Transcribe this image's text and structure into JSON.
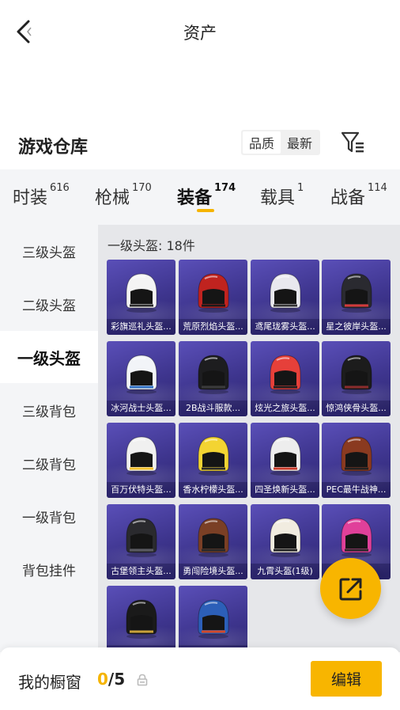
{
  "header": {
    "title": "资产"
  },
  "section": {
    "title": "游戏仓库",
    "sort_options": [
      "品质",
      "最新"
    ]
  },
  "tabs": [
    {
      "label": "时装",
      "count": "616"
    },
    {
      "label": "枪械",
      "count": "170"
    },
    {
      "label": "装备",
      "count": "174"
    },
    {
      "label": "载具",
      "count": "1"
    },
    {
      "label": "战备",
      "count": "114"
    }
  ],
  "sidebar": {
    "items": [
      "三级头盔",
      "二级头盔",
      "一级头盔",
      "三级背包",
      "二级背包",
      "一级背包",
      "背包挂件"
    ]
  },
  "content": {
    "header": "一级头盔: 18件",
    "items": [
      {
        "name": "彩旗巡礼头盔...",
        "colors": [
          "#f4f4f4",
          "#2b2b2b"
        ]
      },
      {
        "name": "荒原烈焰头盔...",
        "colors": [
          "#c0231f",
          "#1a1a1a"
        ]
      },
      {
        "name": "鸢尾珑雾头盔...",
        "colors": [
          "#e8e8ee",
          "#333333"
        ]
      },
      {
        "name": "星之彼岸头盔...",
        "colors": [
          "#2a2a30",
          "#d23a3a"
        ]
      },
      {
        "name": "冰河战士头盔...",
        "colors": [
          "#f2f4f8",
          "#2f6fc2"
        ]
      },
      {
        "name": "2B战斗服款...",
        "colors": [
          "#1d1d1f",
          "#3a3a3a"
        ]
      },
      {
        "name": "炫光之旅头盔...",
        "colors": [
          "#e6403a",
          "#1f1f1f"
        ]
      },
      {
        "name": "惊鸿侠骨头盔...",
        "colors": [
          "#1c1c1c",
          "#8a2b2b"
        ]
      },
      {
        "name": "百万伏特头盔...",
        "colors": [
          "#f0f0f0",
          "#f2c12e"
        ]
      },
      {
        "name": "香水柠檬头盔...",
        "colors": [
          "#f3d432",
          "#2a2a2a"
        ]
      },
      {
        "name": "四圣焕新头盔...",
        "colors": [
          "#ededed",
          "#c83a2a"
        ]
      },
      {
        "name": "PEC最牛战神...",
        "colors": [
          "#8a3a20",
          "#222222"
        ]
      },
      {
        "name": "古堡领主头盔...",
        "colors": [
          "#2a2a2e",
          "#5a5a60"
        ]
      },
      {
        "name": "勇闯险境头盔...",
        "colors": [
          "#7a3f25",
          "#2a2a2a"
        ]
      },
      {
        "name": "九霄头盔(1级)",
        "colors": [
          "#f1ece0",
          "#222222"
        ]
      },
      {
        "name": "...",
        "colors": [
          "#e0409a",
          "#2a2a2a"
        ]
      },
      {
        "name": "",
        "colors": [
          "#1a1a1a",
          "#c9a23a"
        ]
      },
      {
        "name": "",
        "colors": [
          "#2c5fb8",
          "#d2492a"
        ]
      }
    ]
  },
  "bottom": {
    "window_label": "我的橱窗",
    "window_current": "0",
    "window_total": "/5",
    "edit_label": "编辑"
  },
  "colors": {
    "accent": "#f8b500",
    "card_bg": "#4a3fa5"
  }
}
